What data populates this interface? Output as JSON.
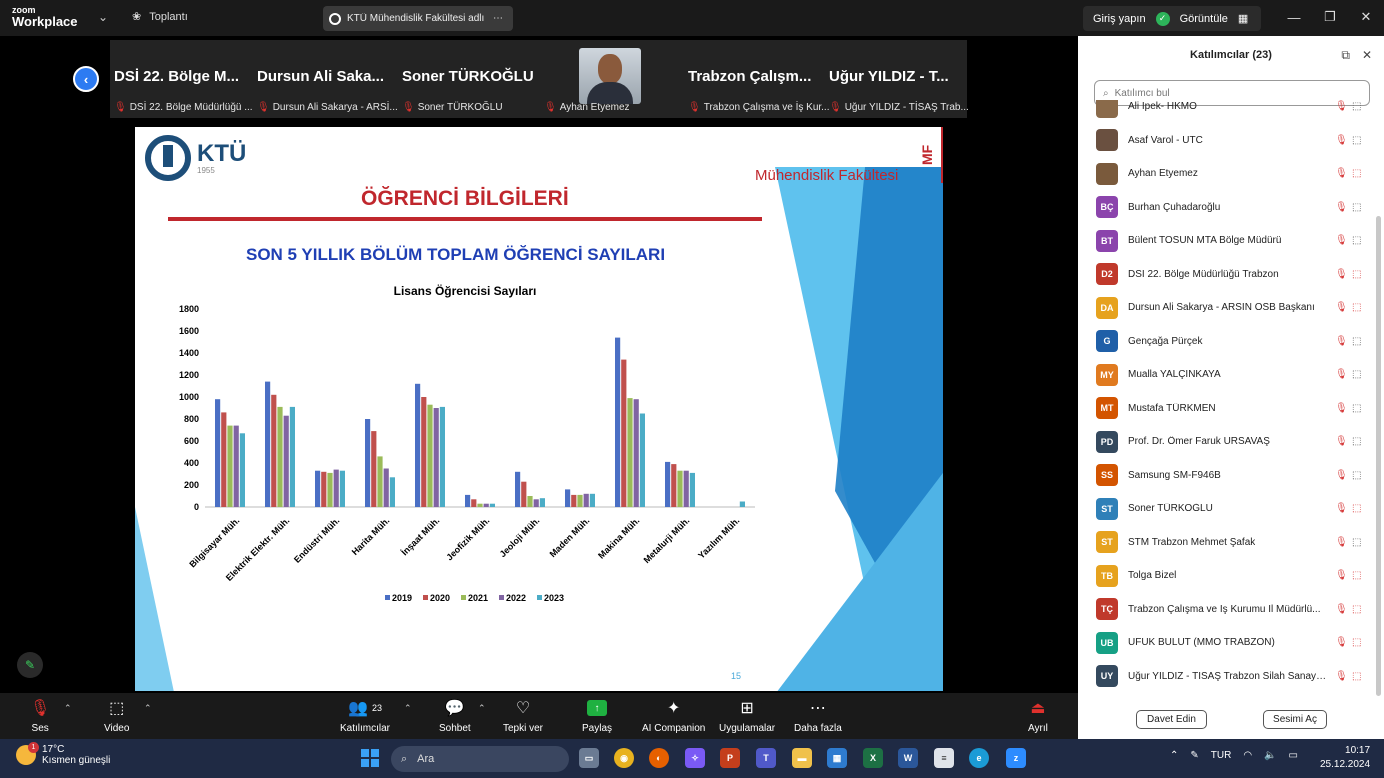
{
  "titlebar": {
    "brand_top": "zoom",
    "brand_bottom": "Workplace",
    "meeting_label": "Toplantı",
    "tab_title": "KTÜ Mühendislik Fakültesi adlı kişi",
    "signin": "Giriş yapın",
    "view_label": "Görüntüle"
  },
  "gallery": {
    "tiles": [
      {
        "big": "DSİ 22. Bölge M...",
        "small": "DSİ 22. Bölge Müdürlüğü ..."
      },
      {
        "big": "Dursun Ali Saka...",
        "small": "Dursun Ali Sakarya - ARSİ..."
      },
      {
        "big": "Soner TÜRKOĞLU",
        "small": "Soner TÜRKOĞLU"
      },
      {
        "big": "",
        "small": "Ayhan Etyemez"
      },
      {
        "big": "Trabzon Çalışm...",
        "small": "Trabzon Çalışma ve İş Kur..."
      },
      {
        "big": "Uğur YILDIZ - T...",
        "small": "Uğur YILDIZ - TİSAŞ Trab..."
      }
    ]
  },
  "slide": {
    "logo_text": "KTÜ",
    "logo_year": "1955",
    "faculty": "Mühendislik Fakültesi",
    "faculty_abbr": "MF",
    "title": "ÖĞRENCİ BİLGİLERİ",
    "subtitle": "SON 5 YILLIK BÖLÜM TOPLAM ÖĞRENCİ SAYILARI",
    "page_number": "15"
  },
  "chart_data": {
    "type": "bar",
    "title": "Lisans Öğrencisi Sayıları",
    "xlabel": "",
    "ylabel": "",
    "ylim": [
      0,
      1800
    ],
    "yticks": [
      0,
      200,
      400,
      600,
      800,
      1000,
      1200,
      1400,
      1600,
      1800
    ],
    "grid": false,
    "legend_position": "bottom",
    "categories": [
      "Bilgisayar Müh.",
      "Elektrik Elektr. Müh.",
      "Endüstri Müh.",
      "Harita Müh.",
      "İnşaat Müh.",
      "Jeofizik Müh.",
      "Jeoloji Müh.",
      "Maden Müh.",
      "Makina Müh.",
      "Metalurji Müh.",
      "Yazılım Müh."
    ],
    "series": [
      {
        "name": "2019",
        "color": "#4a6fc4",
        "values": [
          980,
          1140,
          330,
          800,
          1120,
          110,
          320,
          160,
          1540,
          410,
          0
        ]
      },
      {
        "name": "2020",
        "color": "#c0504d",
        "values": [
          860,
          1020,
          320,
          690,
          1000,
          70,
          230,
          110,
          1340,
          390,
          0
        ]
      },
      {
        "name": "2021",
        "color": "#9bbb59",
        "values": [
          740,
          910,
          310,
          460,
          930,
          30,
          100,
          110,
          990,
          330,
          0
        ]
      },
      {
        "name": "2022",
        "color": "#8064a2",
        "values": [
          740,
          830,
          340,
          350,
          900,
          30,
          70,
          120,
          980,
          330,
          0
        ]
      },
      {
        "name": "2023",
        "color": "#4bacc6",
        "values": [
          670,
          910,
          330,
          270,
          910,
          30,
          80,
          120,
          850,
          310,
          50
        ]
      }
    ]
  },
  "panel": {
    "title": "Katılımcılar (23)",
    "search_placeholder": "Katılımcı bul",
    "participants": [
      {
        "initials": "",
        "name": "Ali İpek- HKMO",
        "color": "#8a6a4a",
        "photo": true,
        "cam_off": false
      },
      {
        "initials": "",
        "name": "Asaf Varol - UTC",
        "color": "#6a5040",
        "photo": true,
        "cam_off": false
      },
      {
        "initials": "",
        "name": "Ayhan Etyemez",
        "color": "#7a5a3c",
        "photo": true,
        "cam_off": true
      },
      {
        "initials": "BÇ",
        "name": "Burhan Çuhadaroğlu",
        "color": "#8b44ac",
        "photo": false,
        "cam_off": false
      },
      {
        "initials": "BT",
        "name": "Bülent TOSUN  MTA Bölge Müdürü",
        "color": "#8b44ac",
        "photo": false,
        "cam_off": false
      },
      {
        "initials": "D2",
        "name": "DSİ 22. Bölge Müdürlüğü Trabzon",
        "color": "#c0392b",
        "photo": false,
        "cam_off": true
      },
      {
        "initials": "DA",
        "name": "Dursun Ali Sakarya - ARSİN OSB Başkanı",
        "color": "#e6a21e",
        "photo": false,
        "cam_off": true
      },
      {
        "initials": "G",
        "name": "Gençağa Pürçek",
        "color": "#1f5fa8",
        "photo": false,
        "cam_off": false
      },
      {
        "initials": "MY",
        "name": "Mualla YALÇINKAYA",
        "color": "#e07a1f",
        "photo": false,
        "cam_off": false
      },
      {
        "initials": "MT",
        "name": "Mustafa TÜRKMEN",
        "color": "#d35400",
        "photo": false,
        "cam_off": false
      },
      {
        "initials": "PD",
        "name": "Prof. Dr. Ömer Faruk URSAVAŞ",
        "color": "#34495e",
        "photo": false,
        "cam_off": false
      },
      {
        "initials": "SS",
        "name": "Samsung SM-F946B",
        "color": "#d35400",
        "photo": false,
        "cam_off": false
      },
      {
        "initials": "ST",
        "name": "Soner TÜRKOĞLU",
        "color": "#2f80b8",
        "photo": false,
        "cam_off": true
      },
      {
        "initials": "ST",
        "name": "STM Trabzon Mehmet Şafak",
        "color": "#e6a21e",
        "photo": false,
        "cam_off": false
      },
      {
        "initials": "TB",
        "name": "Tolga Bizel",
        "color": "#e6a21e",
        "photo": false,
        "cam_off": true
      },
      {
        "initials": "TÇ",
        "name": "Trabzon Çalışma ve İş Kurumu İl Müdürlü...",
        "color": "#c0392b",
        "photo": false,
        "cam_off": true
      },
      {
        "initials": "UB",
        "name": "UFUK BULUT (MMO TRABZON)",
        "color": "#16a085",
        "photo": false,
        "cam_off": true
      },
      {
        "initials": "UY",
        "name": "Uğur YILDIZ - TİSAŞ Trabzon Silah Sanayi ...",
        "color": "#34495e",
        "photo": false,
        "cam_off": true
      }
    ],
    "invite_label": "Davet Edin",
    "unmute_label": "Sesimi Aç"
  },
  "toolbar": {
    "audio": "Ses",
    "video": "Video",
    "participants": "Katılımcılar",
    "participants_count": "23",
    "chat": "Sohbet",
    "react": "Tepki ver",
    "share": "Paylaş",
    "ai": "AI Companion",
    "apps": "Uygulamalar",
    "more": "Daha fazla",
    "leave": "Ayrıl"
  },
  "taskbar": {
    "temperature": "17°C",
    "weather": "Kısmen güneşli",
    "weather_badge": "1",
    "search": "Ara",
    "language": "TUR",
    "time": "10:17",
    "date": "25.12.2024"
  }
}
